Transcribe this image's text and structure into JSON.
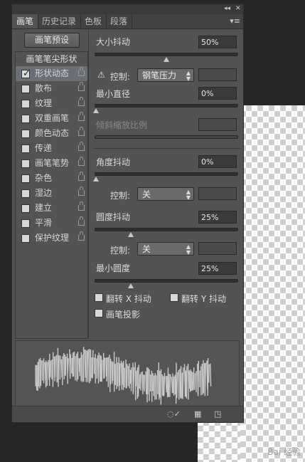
{
  "window_controls": {
    "collapse": "◂◂",
    "close": "✕"
  },
  "tabs": [
    {
      "label": "画笔",
      "active": true
    },
    {
      "label": "历史记录",
      "active": false
    },
    {
      "label": "色板",
      "active": false
    },
    {
      "label": "段落",
      "active": false
    }
  ],
  "panel_menu_icon": "▾≡",
  "brush_presets_button": "画笔预设",
  "brush_list": {
    "header": "画笔笔尖形状",
    "items": [
      {
        "label": "形状动态",
        "checked": true,
        "selected": true
      },
      {
        "label": "散布",
        "checked": false
      },
      {
        "label": "纹理",
        "checked": false
      },
      {
        "label": "双重画笔",
        "checked": false
      },
      {
        "label": "颜色动态",
        "checked": false
      },
      {
        "label": "传递",
        "checked": false
      },
      {
        "label": "画笔笔势",
        "checked": false
      },
      {
        "label": "杂色",
        "checked": false
      },
      {
        "label": "湿边",
        "checked": false
      },
      {
        "label": "建立",
        "checked": false
      },
      {
        "label": "平滑",
        "checked": false
      },
      {
        "label": "保护纹理",
        "checked": false
      }
    ]
  },
  "size_jitter": {
    "label": "大小抖动",
    "value": "50%",
    "slider": 0.5
  },
  "size_control": {
    "warn_icon": "⚠",
    "label": "控制:",
    "value": "钢笔压力"
  },
  "min_diameter": {
    "label": "最小直径",
    "value": "0%",
    "slider": 0
  },
  "tilt_scale": {
    "label": "倾斜缩放比例",
    "disabled": true
  },
  "angle_jitter": {
    "label": "角度抖动",
    "value": "0%",
    "slider": 0
  },
  "angle_control": {
    "label": "控制:",
    "value": "关"
  },
  "roundness_jitter": {
    "label": "圆度抖动",
    "value": "25%",
    "slider": 0.25
  },
  "roundness_control": {
    "label": "控制:",
    "value": "关"
  },
  "min_roundness": {
    "label": "最小圆度",
    "value": "25%",
    "slider": 0.25
  },
  "flip_x": {
    "label": "翻转 X 抖动",
    "checked": false
  },
  "flip_y": {
    "label": "翻转 Y 抖动",
    "checked": false
  },
  "brush_projection": {
    "label": "画笔投影",
    "checked": false
  },
  "watermark": "Bai 经验"
}
